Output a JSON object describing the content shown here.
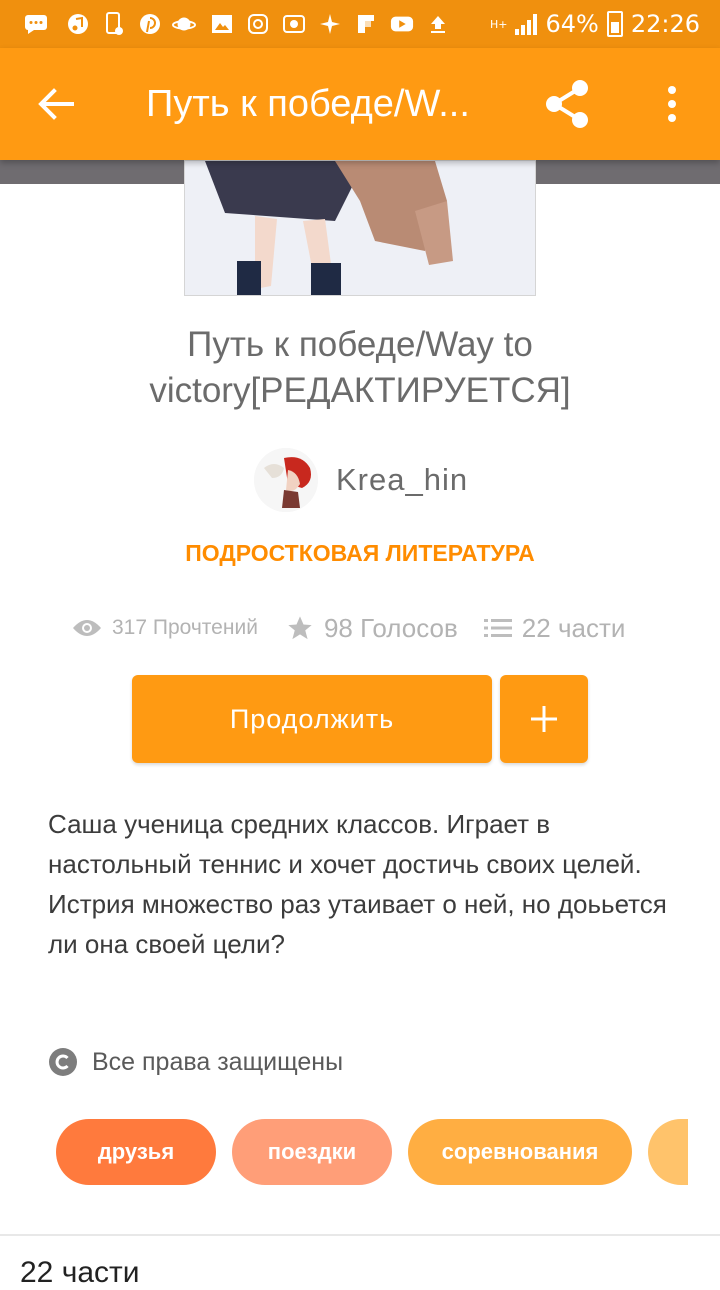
{
  "status_bar": {
    "battery": "64%",
    "time": "22:26",
    "network": "H+",
    "icons": [
      "sms-icon",
      "music-icon",
      "phone-icon",
      "pinterest-icon",
      "planet-icon",
      "image-icon",
      "instagram-icon",
      "cast-icon",
      "pinwheel-icon",
      "flipboard-icon",
      "youtube-icon",
      "upload-icon"
    ]
  },
  "appbar": {
    "title": "Путь к победе/W...",
    "back_icon": "arrow-back-icon",
    "share_icon": "share-icon",
    "more_icon": "more-vert-icon"
  },
  "story": {
    "title": "Путь к победе/Way to victory[РЕДАКТИРУЕТСЯ]",
    "author": "Krea_hin",
    "category": "ПОДРОСТКОВАЯ ЛИТЕРАТУРА",
    "reads": "317 Прочтений",
    "votes": "98 Голосов",
    "parts": "22 части",
    "continue_label": "Продолжить",
    "add_label": "+",
    "description": [
      "Саша ученица средних классов. Играет в настольный теннис и хочет достичь своих целей.",
      "Истрия множество раз утаивает о ней, но доььется ли она своей цели?"
    ],
    "rights": "Все права защищены",
    "tags": [
      "друзья",
      "поездки",
      "соревнования"
    ],
    "parts_heading": "22 части"
  },
  "colors": {
    "status_bar": "#f0900e",
    "app_bar": "#ff9a12",
    "accent": "#ff8c00",
    "tag_1": "#ff7a3d",
    "tag_2": "#ff9e78",
    "tag_3": "#ffae42",
    "tag_4": "#ffc36b"
  }
}
